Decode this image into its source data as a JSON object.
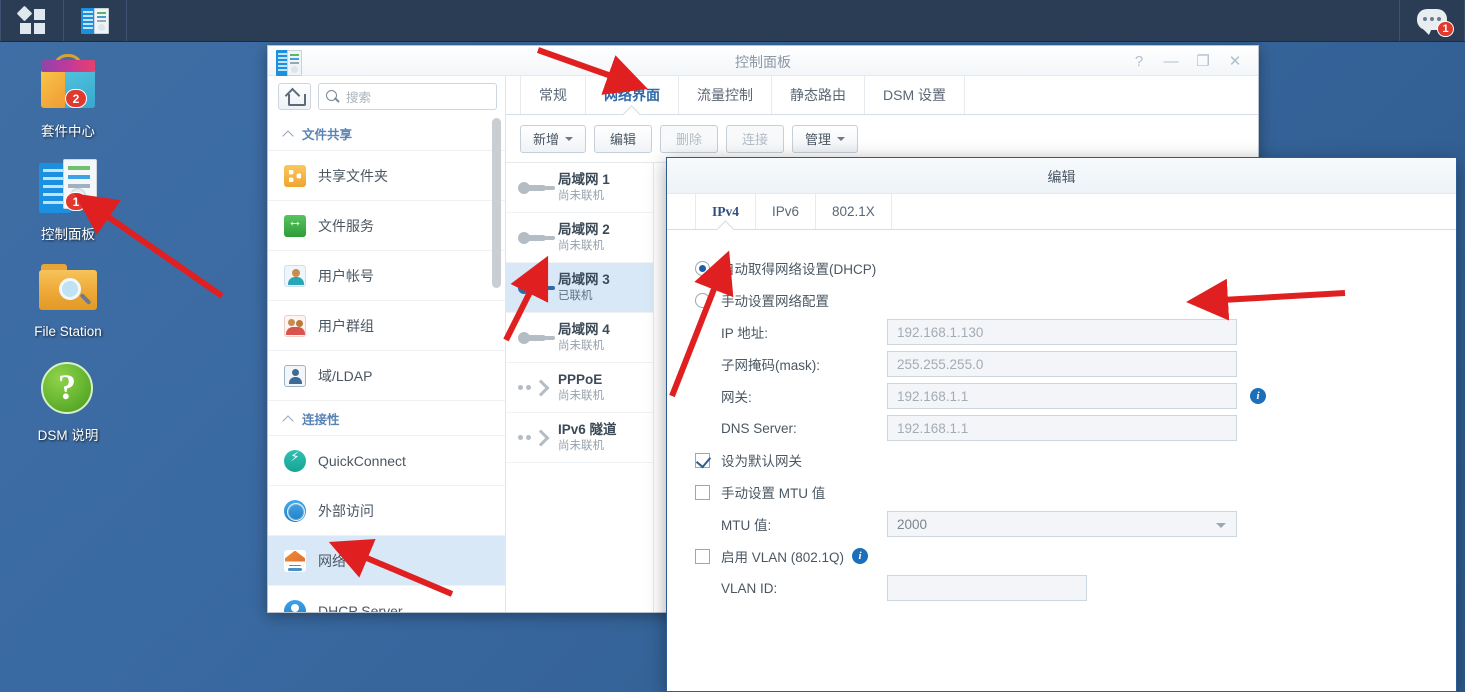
{
  "taskbar": {
    "menu_icon": "app-menu-icon",
    "app_icon": "control-panel-icon",
    "notification_icon": "chat-bubble-icon",
    "notification_count": "1"
  },
  "desktop": {
    "icons": [
      {
        "label": "套件中心",
        "icon": "package-center-icon",
        "badge": "2"
      },
      {
        "label": "控制面板",
        "icon": "control-panel-icon",
        "badge": "1"
      },
      {
        "label": "File Station",
        "icon": "file-station-icon",
        "badge": ""
      },
      {
        "label": "DSM 说明",
        "icon": "dsm-help-icon",
        "badge": ""
      }
    ]
  },
  "control_panel": {
    "title": "控制面板",
    "window_buttons": {
      "help": "?",
      "minimize": "—",
      "maximize": "❐",
      "close": "✕"
    },
    "sidebar": {
      "home_button": "home-icon",
      "search": {
        "placeholder": "搜索",
        "value": ""
      },
      "groups": [
        {
          "label": "文件共享",
          "items": [
            {
              "label": "共享文件夹",
              "icon": "shared-folder-icon"
            },
            {
              "label": "文件服务",
              "icon": "file-service-icon"
            },
            {
              "label": "用户帐号",
              "icon": "user-account-icon"
            },
            {
              "label": "用户群组",
              "icon": "user-group-icon"
            },
            {
              "label": "域/LDAP",
              "icon": "domain-ldap-icon"
            }
          ]
        },
        {
          "label": "连接性",
          "items": [
            {
              "label": "QuickConnect",
              "icon": "quickconnect-icon"
            },
            {
              "label": "外部访问",
              "icon": "external-access-icon"
            },
            {
              "label": "网络",
              "icon": "network-icon",
              "selected": true
            },
            {
              "label": "DHCP Server",
              "icon": "dhcp-server-icon"
            }
          ]
        }
      ]
    },
    "tabs": [
      {
        "label": "常规",
        "active": false
      },
      {
        "label": "网络界面",
        "active": true
      },
      {
        "label": "流量控制",
        "active": false
      },
      {
        "label": "静态路由",
        "active": false
      },
      {
        "label": "DSM 设置",
        "active": false
      }
    ],
    "toolbar": [
      {
        "label": "新增",
        "dropdown": true,
        "disabled": false
      },
      {
        "label": "编辑",
        "dropdown": false,
        "disabled": false
      },
      {
        "label": "删除",
        "dropdown": false,
        "disabled": true
      },
      {
        "label": "连接",
        "dropdown": false,
        "disabled": true
      },
      {
        "label": "管理",
        "dropdown": true,
        "disabled": false
      }
    ],
    "interfaces": [
      {
        "name": "局域网 1",
        "status": "尚未联机",
        "icon": "lan-icon",
        "selected": false
      },
      {
        "name": "局域网 2",
        "status": "尚未联机",
        "icon": "lan-icon",
        "selected": false
      },
      {
        "name": "局域网 3",
        "status": "已联机",
        "icon": "lan-icon",
        "selected": true
      },
      {
        "name": "局域网 4",
        "status": "尚未联机",
        "icon": "lan-icon",
        "selected": false
      },
      {
        "name": "PPPoE",
        "status": "尚未联机",
        "icon": "connection-icon",
        "selected": false
      },
      {
        "name": "IPv6 隧道",
        "status": "尚未联机",
        "icon": "connection-icon",
        "selected": false
      }
    ]
  },
  "edit_dialog": {
    "title": "编辑",
    "tabs": [
      {
        "label": "IPv4",
        "active": true
      },
      {
        "label": "IPv6",
        "active": false
      },
      {
        "label": "802.1X",
        "active": false
      }
    ],
    "radio_dhcp": {
      "label": "自动取得网络设置(DHCP)",
      "checked": true
    },
    "radio_manual": {
      "label": "手动设置网络配置",
      "checked": false
    },
    "fields": [
      {
        "label": "IP 地址:",
        "value": "192.168.1.130",
        "info": false
      },
      {
        "label": "子网掩码(mask):",
        "value": "255.255.255.0",
        "info": false
      },
      {
        "label": "网关:",
        "value": "192.168.1.1",
        "info": true
      },
      {
        "label": "DNS Server:",
        "value": "192.168.1.1",
        "info": false
      }
    ],
    "chk_default_gateway": {
      "label": "设为默认网关",
      "checked": true
    },
    "chk_manual_mtu": {
      "label": "手动设置 MTU 值",
      "checked": false
    },
    "mtu_field": {
      "label": "MTU 值:",
      "value": "2000"
    },
    "chk_vlan": {
      "label": "启用 VLAN (802.1Q)",
      "checked": false,
      "info": true
    },
    "vlan_field": {
      "label": "VLAN ID:",
      "value": ""
    }
  },
  "colors": {
    "desktop_bg": "#3a6aa2",
    "taskbar_bg": "#2b3d55",
    "accent_blue": "#2f6aa8",
    "selection_blue": "#d9e8f7",
    "badge_red": "#e03a30",
    "annotation_red": "#e02020"
  }
}
